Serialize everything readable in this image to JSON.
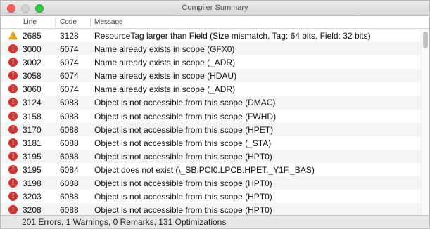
{
  "window": {
    "title": "Compiler Summary"
  },
  "columns": {
    "line": "Line",
    "code": "Code",
    "message": "Message"
  },
  "rows": [
    {
      "type": "warning",
      "line": "2685",
      "code": "3128",
      "message": "ResourceTag larger than Field (Size mismatch, Tag: 64 bits, Field: 32 bits)"
    },
    {
      "type": "error",
      "line": "3000",
      "code": "6074",
      "message": "Name already exists in scope (GFX0)"
    },
    {
      "type": "error",
      "line": "3002",
      "code": "6074",
      "message": "Name already exists in scope (_ADR)"
    },
    {
      "type": "error",
      "line": "3058",
      "code": "6074",
      "message": "Name already exists in scope (HDAU)"
    },
    {
      "type": "error",
      "line": "3060",
      "code": "6074",
      "message": "Name already exists in scope (_ADR)"
    },
    {
      "type": "error",
      "line": "3124",
      "code": "6088",
      "message": "Object is not accessible from this scope (DMAC)"
    },
    {
      "type": "error",
      "line": "3158",
      "code": "6088",
      "message": "Object is not accessible from this scope (FWHD)"
    },
    {
      "type": "error",
      "line": "3170",
      "code": "6088",
      "message": "Object is not accessible from this scope (HPET)"
    },
    {
      "type": "error",
      "line": "3181",
      "code": "6088",
      "message": "Object is not accessible from this scope (_STA)"
    },
    {
      "type": "error",
      "line": "3195",
      "code": "6088",
      "message": "Object is not accessible from this scope (HPT0)"
    },
    {
      "type": "error",
      "line": "3195",
      "code": "6084",
      "message": "Object does not exist (\\_SB.PCI0.LPCB.HPET._Y1F._BAS)"
    },
    {
      "type": "error",
      "line": "3198",
      "code": "6088",
      "message": "Object is not accessible from this scope (HPT0)"
    },
    {
      "type": "error",
      "line": "3203",
      "code": "6088",
      "message": "Object is not accessible from this scope (HPT0)"
    },
    {
      "type": "error",
      "line": "3208",
      "code": "6088",
      "message": "Object is not accessible from this scope (HPT0)"
    }
  ],
  "status": {
    "summary": "201 Errors, 1 Warnings, 0 Remarks, 131 Optimizations"
  },
  "colors": {
    "error": "#d9302b",
    "warning": "#f0b400",
    "close": "#fc5f57",
    "maximize": "#35c94a"
  },
  "icons": {
    "error": "error-icon",
    "warning": "warning-icon"
  }
}
